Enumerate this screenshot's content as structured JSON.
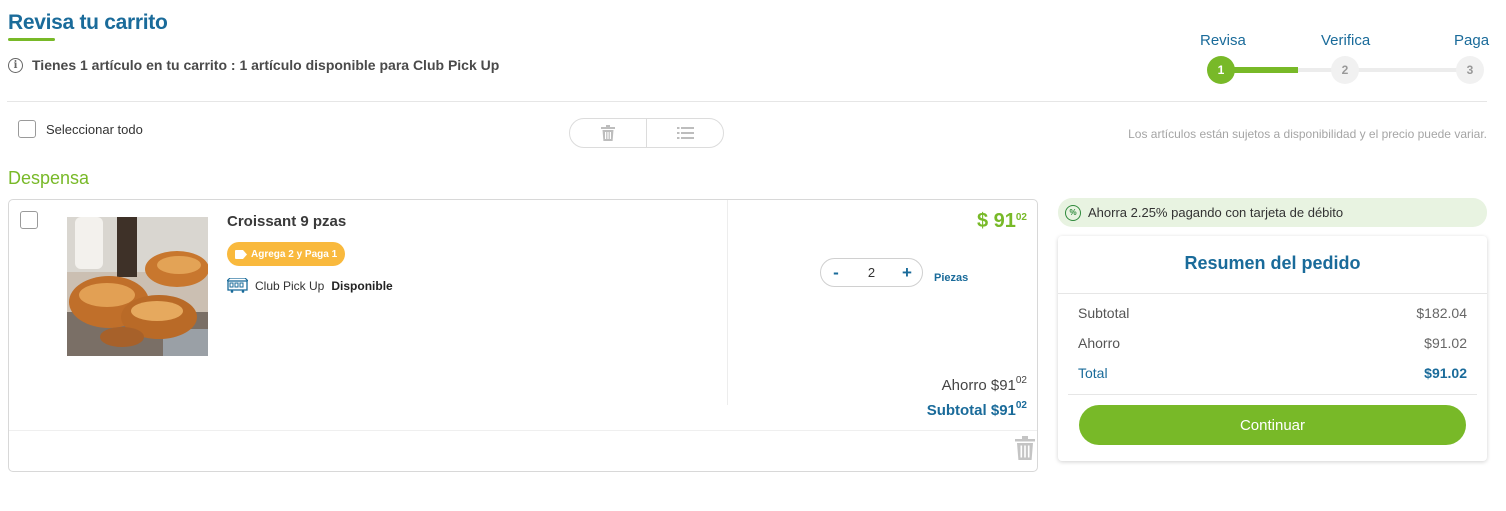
{
  "header": {
    "title": "Revisa tu carrito",
    "info_text": "Tienes 1 artículo en tu carrito : 1 artículo disponible para Club Pick Up"
  },
  "stepper": {
    "steps": [
      {
        "label": "Revisa",
        "number": "1",
        "state": "active"
      },
      {
        "label": "Verifica",
        "number": "2",
        "state": "pending"
      },
      {
        "label": "Paga",
        "number": "3",
        "state": "pending"
      }
    ],
    "progress_fraction": 0.33
  },
  "toolbar": {
    "select_all_label": "Seleccionar todo",
    "availability_note": "Los artículos están sujetos a disponibilidad y el precio puede variar."
  },
  "section": {
    "title": "Despensa"
  },
  "product": {
    "name": "Croissant 9 pzas",
    "promo_label": "Agrega 2 y Paga 1",
    "pickup_label": "Club Pick Up",
    "pickup_status": "Disponible",
    "price_currency": "$",
    "price_whole": "91",
    "price_cents": "02",
    "quantity": "2",
    "qty_minus": "-",
    "qty_plus": "+",
    "unit_label": "Piezas",
    "savings_label": "Ahorro $91",
    "savings_cents": "02",
    "subtotal_label": "Subtotal $91",
    "subtotal_cents": "02"
  },
  "summary": {
    "debit_banner": "Ahorra 2.25% pagando con tarjeta de débito",
    "title": "Resumen del pedido",
    "rows": [
      {
        "label": "Subtotal",
        "value": "$182.04"
      },
      {
        "label": "Ahorro",
        "value": "$91.02"
      },
      {
        "label": "Total",
        "value": "$91.02"
      }
    ],
    "continue_label": "Continuar"
  },
  "colors": {
    "brand_blue": "#1a6b9a",
    "brand_green": "#78b928",
    "promo_orange": "#f9b93d"
  }
}
